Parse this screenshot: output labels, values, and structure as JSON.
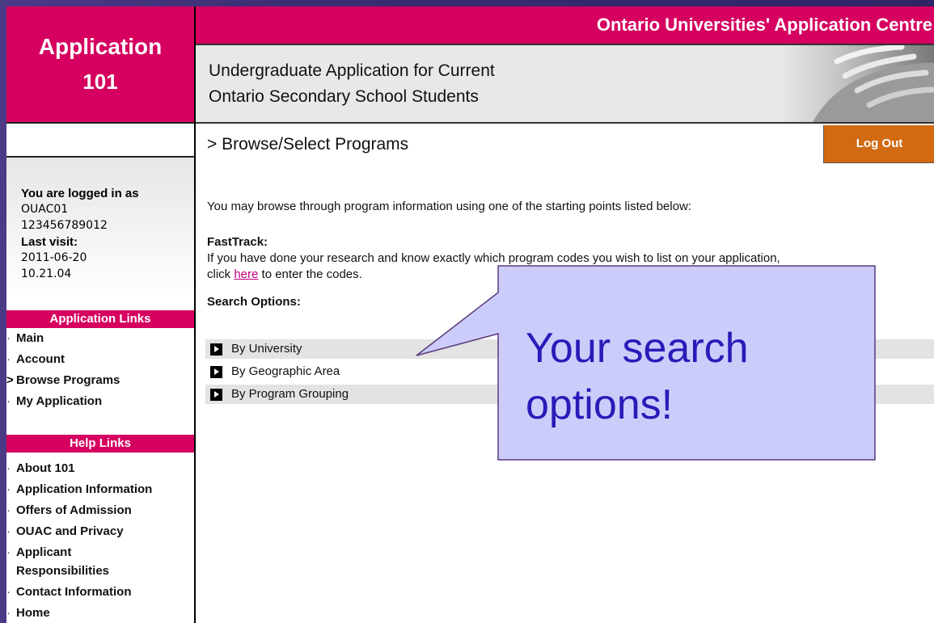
{
  "window": {
    "org_title": "Ontario Universities' Application Centre"
  },
  "logo": {
    "line1": "Application",
    "line2": "101"
  },
  "header": {
    "subtitle_line1": "Undergraduate Application for Current",
    "subtitle_line2": "Ontario Secondary School Students"
  },
  "login": {
    "logged_in_label": "You are logged in as",
    "user_id": "OUAC01",
    "account_number": "123456789012",
    "last_visit_label": "Last visit:",
    "last_visit_date": "2011-06-20",
    "last_visit_time": "10.21.04"
  },
  "app_links": {
    "header": "Application Links",
    "items": [
      {
        "marker": "·",
        "label": "Main"
      },
      {
        "marker": "·",
        "label": "Account"
      },
      {
        "marker": ">",
        "label": "Browse Programs"
      },
      {
        "marker": "·",
        "label": "My Application"
      }
    ]
  },
  "help_links": {
    "header": "Help Links",
    "items": [
      {
        "marker": "·",
        "label": "About 101"
      },
      {
        "marker": "·",
        "label": "Application Information"
      },
      {
        "marker": "·",
        "label": "Offers of Admission"
      },
      {
        "marker": "·",
        "label": "OUAC and Privacy"
      },
      {
        "marker": "·",
        "label": "Applicant"
      },
      {
        "marker": "",
        "label": "Responsibilities"
      },
      {
        "marker": "·",
        "label": "Contact Information"
      },
      {
        "marker": "·",
        "label": "Home"
      }
    ]
  },
  "main": {
    "breadcrumb": ">  Browse/Select Programs",
    "logout_label": "Log Out",
    "intro": "You may browse through program information using one of the starting points listed below:",
    "fasttrack_label": "FastTrack:",
    "fasttrack_text1": "If you have done your research and know exactly which program codes you wish to list on your application,",
    "fasttrack_click": "click ",
    "fasttrack_here": "here",
    "fasttrack_rest": " to enter the codes.",
    "search_options_label": "Search Options:",
    "options": [
      {
        "label": "By University"
      },
      {
        "label": "By Geographic Area"
      },
      {
        "label": "By Program Grouping"
      }
    ]
  },
  "callout": {
    "line1": "Your search",
    "line2": "options!"
  },
  "colors": {
    "brand": "#d5005f",
    "logout": "#d26a12",
    "callout_fill": "#ccccfb",
    "callout_text": "#2a1ab8"
  }
}
